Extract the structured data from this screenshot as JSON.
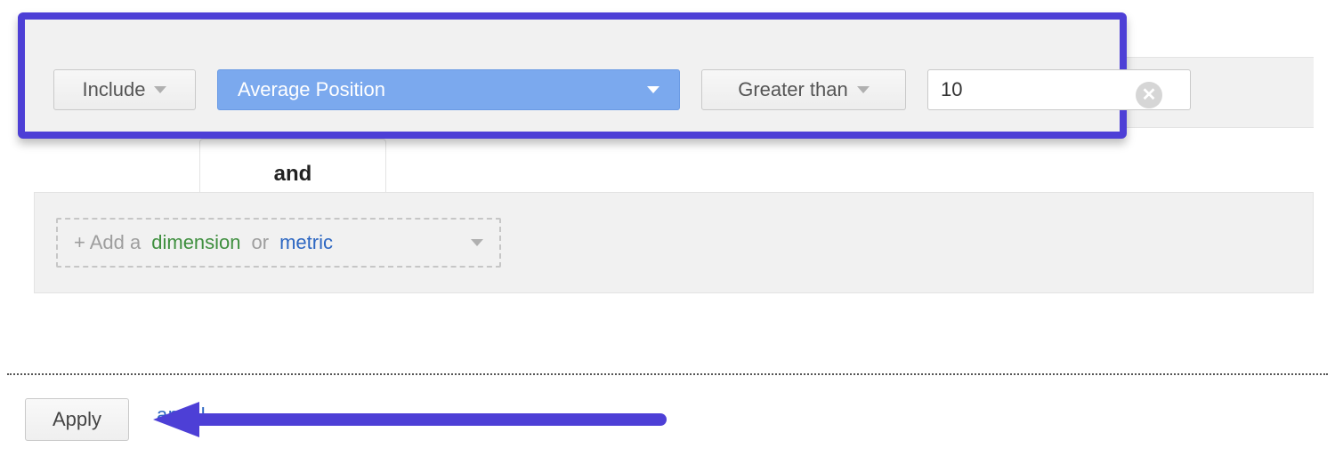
{
  "colors": {
    "highlight_border": "#4d3fd6",
    "primary_blue": "#7ba9ee",
    "dimension_green": "#3f8f3f",
    "metric_blue": "#2d67c2"
  },
  "filter_row": {
    "include_label": "Include",
    "dimension_label": "Average Position",
    "condition_label": "Greater than",
    "value": "10"
  },
  "conjunction_label": "and",
  "add_row": {
    "prefix": "+ Add a ",
    "dimension_word": "dimension",
    "middle": " or ",
    "metric_word": "metric"
  },
  "apply_label": "Apply",
  "cancel_ghost_fragment": "ancel"
}
